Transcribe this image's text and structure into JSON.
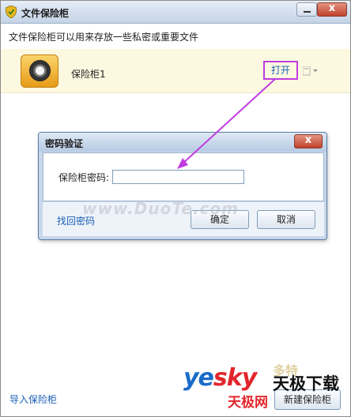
{
  "window": {
    "title": "文件保险柜",
    "description": "文件保险柜可以用来存放一些私密或重要文件",
    "close_glyph": "x"
  },
  "vault": {
    "name": "保险柜1",
    "open_label": "打开",
    "dropdown_icon": "chevron-down-icon"
  },
  "footer": {
    "import_label": "导入保险柜",
    "new_label": "新建保险柜"
  },
  "dialog": {
    "title": "密码验证",
    "close_glyph": "x",
    "password_label": "保险柜密码:",
    "password_value": "",
    "forgot_label": "找回密码",
    "ok_label": "确定",
    "cancel_label": "取消"
  },
  "watermarks": {
    "duote": "www.DuoTe.com",
    "duote_cn": "多特",
    "yesky_yes": "ye",
    "yesky_sky": "sky",
    "yesky_cn": "天极网",
    "tianji": "天极下载"
  },
  "colors": {
    "link": "#1a5fb4",
    "annotation": "#c03ce0",
    "vault_row_bg": "#fdf9e0",
    "dialog_frame": "#c8d8ec"
  }
}
